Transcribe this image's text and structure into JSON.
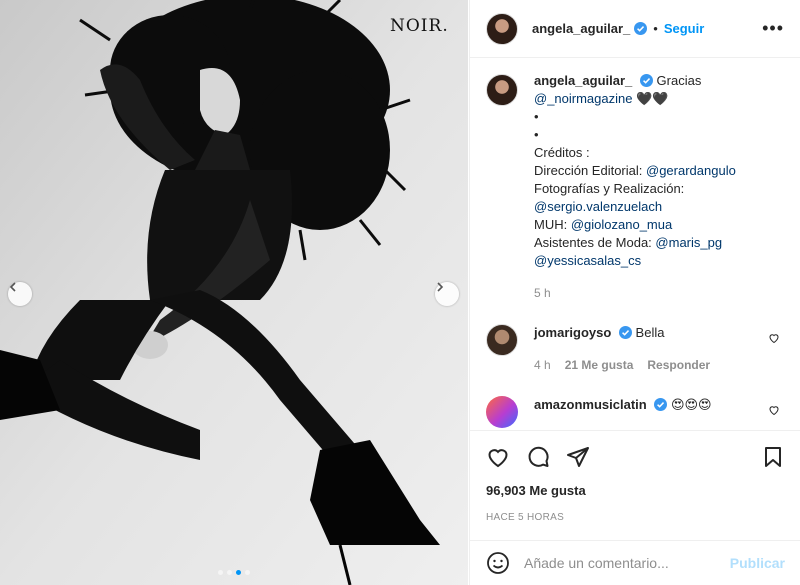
{
  "media": {
    "brand_text": "NOIR.",
    "carousel_count": 4,
    "carousel_active_index": 2
  },
  "header": {
    "username": "angela_aguilar_",
    "separator": "•",
    "follow_label": "Seguir",
    "more_label": "•••"
  },
  "caption": {
    "username": "angela_aguilar_",
    "text_intro": "Gracias",
    "mention_magazine": "@_noirmagazine",
    "hearts": "🖤🖤",
    "bullet1": "•",
    "bullet2": "•",
    "credits_label": "Créditos :",
    "direction_label": "Dirección Editorial:",
    "direction_user": "@gerardangulo",
    "photo_label": "Fotografías y Realización:",
    "photo_user": "@sergio.valenzuelach",
    "muh_label": "MUH:",
    "muh_user": "@giolozano_mua",
    "assist_label": "Asistentes de Moda:",
    "assist_user1": "@maris_pg",
    "assist_user2": "@yessicasalas_cs",
    "time": "5 h"
  },
  "comments": [
    {
      "username": "jomarigoyso",
      "text": "Bella",
      "time": "4 h",
      "likes": "21 Me gusta",
      "reply": "Responder"
    },
    {
      "username": "amazonmusiclatin",
      "text": "😍😍😍"
    }
  ],
  "actions": {
    "likes_count": "96,903 Me gusta",
    "posted": "HACE 5 HORAS"
  },
  "add_comment": {
    "placeholder": "Añade un comentario...",
    "post_label": "Publicar"
  },
  "colors": {
    "accent": "#0095f6",
    "link": "#00376b",
    "muted": "#8e8e8e"
  }
}
